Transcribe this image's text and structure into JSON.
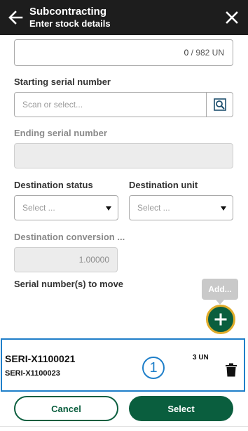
{
  "header": {
    "title": "Subcontracting",
    "subtitle": "Enter stock details",
    "back_icon": "arrow-left-icon",
    "close_icon": "close-icon"
  },
  "quantity": {
    "current": "0",
    "separator": " / ",
    "total": "982 UN"
  },
  "starting_serial": {
    "label": "Starting serial number",
    "placeholder": "Scan or select...",
    "lookup_icon": "search-icon"
  },
  "ending_serial": {
    "label": "Ending serial number",
    "value": ""
  },
  "destination_status": {
    "label": "Destination status",
    "placeholder": "Select ..."
  },
  "destination_unit": {
    "label": "Destination unit",
    "placeholder": "Select ..."
  },
  "destination_conversion": {
    "label": "Destination conversion ...",
    "value": "1.00000"
  },
  "serials_to_move": {
    "label": "Serial number(s) to move",
    "add_tooltip": "Add...",
    "add_icon": "plus-icon"
  },
  "serial_list": [
    {
      "from": "SERI-X1100021",
      "to": "SERI-X1100023",
      "quantity": "3 UN",
      "badge": "1",
      "delete_icon": "trash-icon"
    }
  ],
  "footer": {
    "cancel_label": "Cancel",
    "select_label": "Select"
  },
  "colors": {
    "header_bg": "#1d1d1d",
    "primary_green": "#0a5e3e",
    "highlight_blue": "#1f7fc9",
    "fab_ring": "#e0ac2a"
  }
}
